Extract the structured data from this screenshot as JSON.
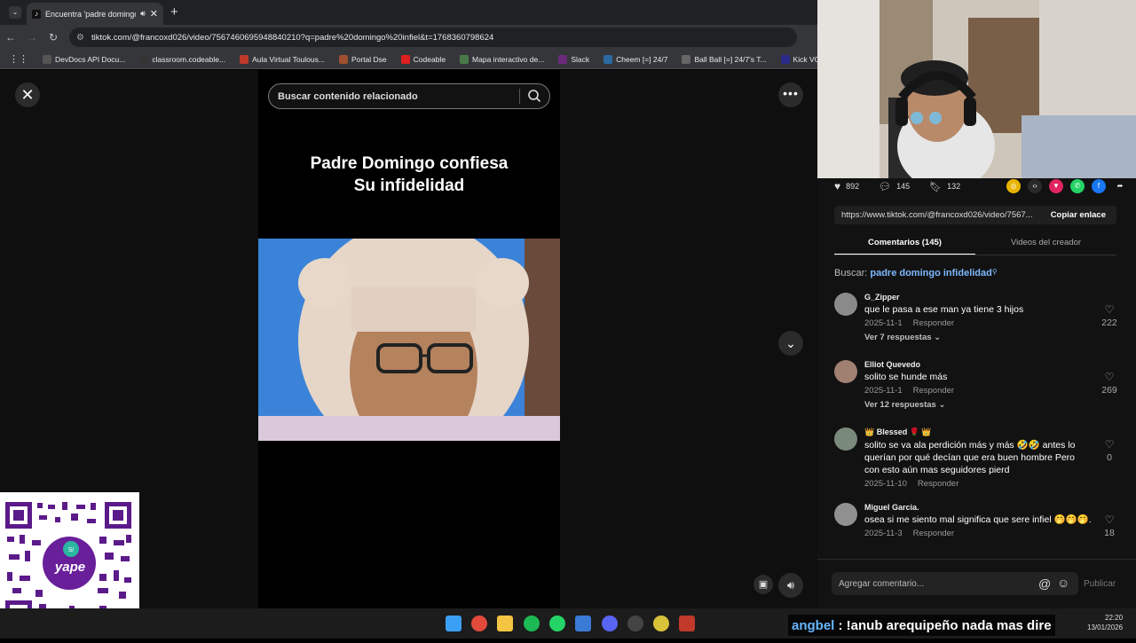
{
  "browser": {
    "tab_title": "Encuentra 'padre domingo",
    "url": "tiktok.com/@francoxd026/video/7567460695948840210?q=padre%20domingo%20infiel&t=1768360798624",
    "bookmarks": [
      {
        "label": "DevDocs API Docu...",
        "color": "#555"
      },
      {
        "label": "classroom.codeable...",
        "color": "#333"
      },
      {
        "label": "Aula Virtual Toulous...",
        "color": "#c0392b"
      },
      {
        "label": "Portal Dse",
        "color": "#a05030"
      },
      {
        "label": "Codeable",
        "color": "#e02020"
      },
      {
        "label": "Mapa interactivo de...",
        "color": "#4a7a4a"
      },
      {
        "label": "Slack",
        "color": "#6a2a7a"
      },
      {
        "label": "Cheem [=] 24/7",
        "color": "#2a6aa0"
      },
      {
        "label": "Ball Ball [=] 24/7's T...",
        "color": "#666"
      },
      {
        "label": "Kick VOD Download...",
        "color": "#2a2a8a"
      }
    ]
  },
  "viewer": {
    "search_placeholder": "Buscar contenido relacionado",
    "video_title_line1": "Padre Domingo confiesa",
    "video_title_line2": "Su infidelidad"
  },
  "panel": {
    "likes": "892",
    "comments_count": "145",
    "saves": "132",
    "share_link": "https://www.tiktok.com/@francoxd026/video/7567...",
    "copy_link_label": "Copiar enlace",
    "tab_comments": "Comentarios (145)",
    "tab_creator": "Videos del creador",
    "search_prefix": "Buscar:",
    "search_query": "padre domingo infidelidad",
    "comments": [
      {
        "user": "G_Zipper",
        "text": "que le pasa a ese man ya tiene 3 hijos",
        "date": "2025-11-1",
        "reply": "Responder",
        "replies": "Ver 7 respuestas",
        "likes": "222",
        "avatar": "#8a8a8a"
      },
      {
        "user": "Elliot Quevedo",
        "text": "solito se hunde más",
        "date": "2025-11-1",
        "reply": "Responder",
        "replies": "Ver 12 respuestas",
        "likes": "269",
        "avatar": "#a08070"
      },
      {
        "user": "👑 Blessed 🌹 👑",
        "text": "solito se va ala perdición más y más 🤣🤣 antes lo querían por qué decían que era buen hombre Pero con esto aún mas seguidores pierd",
        "date": "2025-11-10",
        "reply": "Responder",
        "replies": "",
        "likes": "0",
        "avatar": "#7a8a7a"
      },
      {
        "user": "Miguel Garcia.",
        "text": "osea si me siento mal significa que sere infiel 🤭🤭🤭.",
        "date": "2025-11-3",
        "reply": "Responder",
        "replies": "",
        "likes": "18",
        "avatar": "#909090"
      }
    ],
    "comment_placeholder": "Agregar comentario...",
    "publish_label": "Publicar"
  },
  "overlay": {
    "chat_user": "angbel",
    "chat_message": ": !anub arequipeño nada mas dire",
    "clock_time": "22:20",
    "clock_date": "13/01/2026"
  }
}
